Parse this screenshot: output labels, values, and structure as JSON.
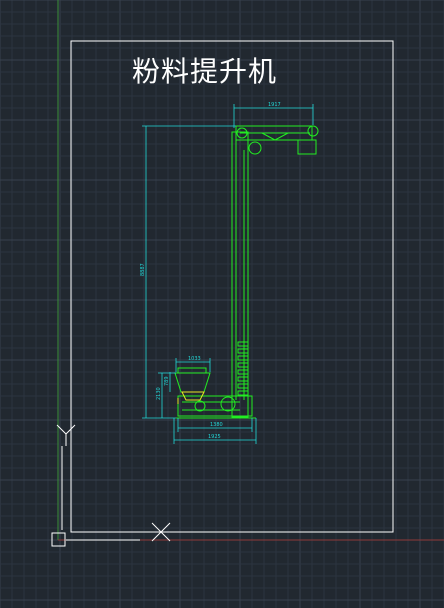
{
  "drawing": {
    "title": "粉料提升机",
    "dims": {
      "top_width": "1917",
      "height_total": "8887",
      "hopper_width": "1033",
      "hopper_height": "789",
      "base_height": "2130",
      "base_width": "1380",
      "overall_width": "1925"
    }
  },
  "ucs": {
    "y_label": "Y",
    "x_label": "X"
  },
  "colors": {
    "background": "#212830",
    "grid_minor": "#2c3440",
    "grid_major": "#37414e",
    "sheet": "#ffffff",
    "machine": "#22ee22",
    "dimension": "#22d8d8",
    "accent": "#e6e622",
    "axis_y": "#3a8f3a",
    "axis_x": "#8f3a3a"
  }
}
